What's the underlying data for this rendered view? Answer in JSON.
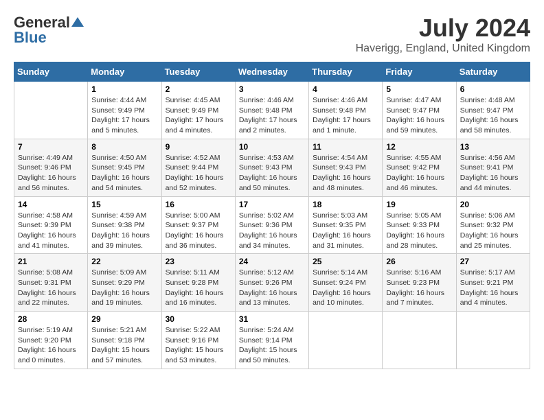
{
  "header": {
    "logo_general": "General",
    "logo_blue": "Blue",
    "month_title": "July 2024",
    "location": "Haverigg, England, United Kingdom"
  },
  "weekdays": [
    "Sunday",
    "Monday",
    "Tuesday",
    "Wednesday",
    "Thursday",
    "Friday",
    "Saturday"
  ],
  "weeks": [
    [
      {
        "day": "",
        "sunrise": "",
        "sunset": "",
        "daylight": ""
      },
      {
        "day": "1",
        "sunrise": "Sunrise: 4:44 AM",
        "sunset": "Sunset: 9:49 PM",
        "daylight": "Daylight: 17 hours and 5 minutes."
      },
      {
        "day": "2",
        "sunrise": "Sunrise: 4:45 AM",
        "sunset": "Sunset: 9:49 PM",
        "daylight": "Daylight: 17 hours and 4 minutes."
      },
      {
        "day": "3",
        "sunrise": "Sunrise: 4:46 AM",
        "sunset": "Sunset: 9:48 PM",
        "daylight": "Daylight: 17 hours and 2 minutes."
      },
      {
        "day": "4",
        "sunrise": "Sunrise: 4:46 AM",
        "sunset": "Sunset: 9:48 PM",
        "daylight": "Daylight: 17 hours and 1 minute."
      },
      {
        "day": "5",
        "sunrise": "Sunrise: 4:47 AM",
        "sunset": "Sunset: 9:47 PM",
        "daylight": "Daylight: 16 hours and 59 minutes."
      },
      {
        "day": "6",
        "sunrise": "Sunrise: 4:48 AM",
        "sunset": "Sunset: 9:47 PM",
        "daylight": "Daylight: 16 hours and 58 minutes."
      }
    ],
    [
      {
        "day": "7",
        "sunrise": "Sunrise: 4:49 AM",
        "sunset": "Sunset: 9:46 PM",
        "daylight": "Daylight: 16 hours and 56 minutes."
      },
      {
        "day": "8",
        "sunrise": "Sunrise: 4:50 AM",
        "sunset": "Sunset: 9:45 PM",
        "daylight": "Daylight: 16 hours and 54 minutes."
      },
      {
        "day": "9",
        "sunrise": "Sunrise: 4:52 AM",
        "sunset": "Sunset: 9:44 PM",
        "daylight": "Daylight: 16 hours and 52 minutes."
      },
      {
        "day": "10",
        "sunrise": "Sunrise: 4:53 AM",
        "sunset": "Sunset: 9:43 PM",
        "daylight": "Daylight: 16 hours and 50 minutes."
      },
      {
        "day": "11",
        "sunrise": "Sunrise: 4:54 AM",
        "sunset": "Sunset: 9:43 PM",
        "daylight": "Daylight: 16 hours and 48 minutes."
      },
      {
        "day": "12",
        "sunrise": "Sunrise: 4:55 AM",
        "sunset": "Sunset: 9:42 PM",
        "daylight": "Daylight: 16 hours and 46 minutes."
      },
      {
        "day": "13",
        "sunrise": "Sunrise: 4:56 AM",
        "sunset": "Sunset: 9:41 PM",
        "daylight": "Daylight: 16 hours and 44 minutes."
      }
    ],
    [
      {
        "day": "14",
        "sunrise": "Sunrise: 4:58 AM",
        "sunset": "Sunset: 9:39 PM",
        "daylight": "Daylight: 16 hours and 41 minutes."
      },
      {
        "day": "15",
        "sunrise": "Sunrise: 4:59 AM",
        "sunset": "Sunset: 9:38 PM",
        "daylight": "Daylight: 16 hours and 39 minutes."
      },
      {
        "day": "16",
        "sunrise": "Sunrise: 5:00 AM",
        "sunset": "Sunset: 9:37 PM",
        "daylight": "Daylight: 16 hours and 36 minutes."
      },
      {
        "day": "17",
        "sunrise": "Sunrise: 5:02 AM",
        "sunset": "Sunset: 9:36 PM",
        "daylight": "Daylight: 16 hours and 34 minutes."
      },
      {
        "day": "18",
        "sunrise": "Sunrise: 5:03 AM",
        "sunset": "Sunset: 9:35 PM",
        "daylight": "Daylight: 16 hours and 31 minutes."
      },
      {
        "day": "19",
        "sunrise": "Sunrise: 5:05 AM",
        "sunset": "Sunset: 9:33 PM",
        "daylight": "Daylight: 16 hours and 28 minutes."
      },
      {
        "day": "20",
        "sunrise": "Sunrise: 5:06 AM",
        "sunset": "Sunset: 9:32 PM",
        "daylight": "Daylight: 16 hours and 25 minutes."
      }
    ],
    [
      {
        "day": "21",
        "sunrise": "Sunrise: 5:08 AM",
        "sunset": "Sunset: 9:31 PM",
        "daylight": "Daylight: 16 hours and 22 minutes."
      },
      {
        "day": "22",
        "sunrise": "Sunrise: 5:09 AM",
        "sunset": "Sunset: 9:29 PM",
        "daylight": "Daylight: 16 hours and 19 minutes."
      },
      {
        "day": "23",
        "sunrise": "Sunrise: 5:11 AM",
        "sunset": "Sunset: 9:28 PM",
        "daylight": "Daylight: 16 hours and 16 minutes."
      },
      {
        "day": "24",
        "sunrise": "Sunrise: 5:12 AM",
        "sunset": "Sunset: 9:26 PM",
        "daylight": "Daylight: 16 hours and 13 minutes."
      },
      {
        "day": "25",
        "sunrise": "Sunrise: 5:14 AM",
        "sunset": "Sunset: 9:24 PM",
        "daylight": "Daylight: 16 hours and 10 minutes."
      },
      {
        "day": "26",
        "sunrise": "Sunrise: 5:16 AM",
        "sunset": "Sunset: 9:23 PM",
        "daylight": "Daylight: 16 hours and 7 minutes."
      },
      {
        "day": "27",
        "sunrise": "Sunrise: 5:17 AM",
        "sunset": "Sunset: 9:21 PM",
        "daylight": "Daylight: 16 hours and 4 minutes."
      }
    ],
    [
      {
        "day": "28",
        "sunrise": "Sunrise: 5:19 AM",
        "sunset": "Sunset: 9:20 PM",
        "daylight": "Daylight: 16 hours and 0 minutes."
      },
      {
        "day": "29",
        "sunrise": "Sunrise: 5:21 AM",
        "sunset": "Sunset: 9:18 PM",
        "daylight": "Daylight: 15 hours and 57 minutes."
      },
      {
        "day": "30",
        "sunrise": "Sunrise: 5:22 AM",
        "sunset": "Sunset: 9:16 PM",
        "daylight": "Daylight: 15 hours and 53 minutes."
      },
      {
        "day": "31",
        "sunrise": "Sunrise: 5:24 AM",
        "sunset": "Sunset: 9:14 PM",
        "daylight": "Daylight: 15 hours and 50 minutes."
      },
      {
        "day": "",
        "sunrise": "",
        "sunset": "",
        "daylight": ""
      },
      {
        "day": "",
        "sunrise": "",
        "sunset": "",
        "daylight": ""
      },
      {
        "day": "",
        "sunrise": "",
        "sunset": "",
        "daylight": ""
      }
    ]
  ]
}
